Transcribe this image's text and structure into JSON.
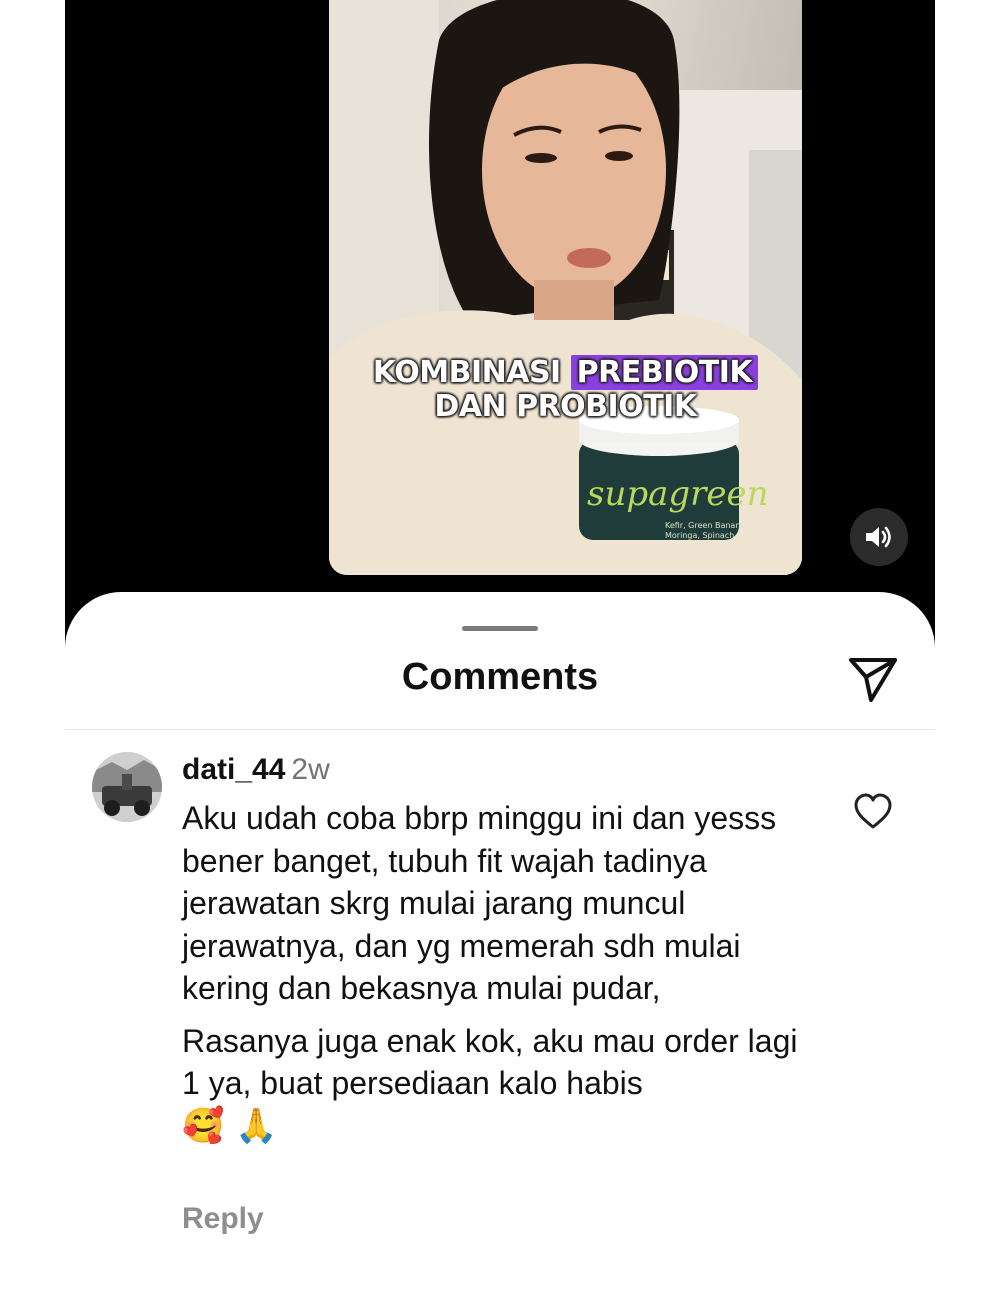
{
  "video": {
    "caption_line1_part1": "KOMBINASI",
    "caption_line1_highlight": "PREBIOTIK",
    "caption_line2": "DAN PROBIOTIK",
    "product_brand": "supagreen",
    "product_subtext": "Kefir, Green Banana, Moringa, Spinach"
  },
  "sheet": {
    "title": "Comments"
  },
  "comment": {
    "username": "dati_44",
    "time": "2w",
    "paragraph1": "Aku udah coba bbrp minggu ini dan yesss bener banget, tubuh fit wajah tadinya jerawatan skrg mulai jarang muncul jerawatnya, dan yg memerah sdh mulai kering dan bekasnya mulai pudar,",
    "paragraph2": "Rasanya juga enak kok, aku mau order lagi 1 ya, buat persediaan kalo habis",
    "emojis": "🥰 🙏",
    "reply_label": "Reply"
  }
}
